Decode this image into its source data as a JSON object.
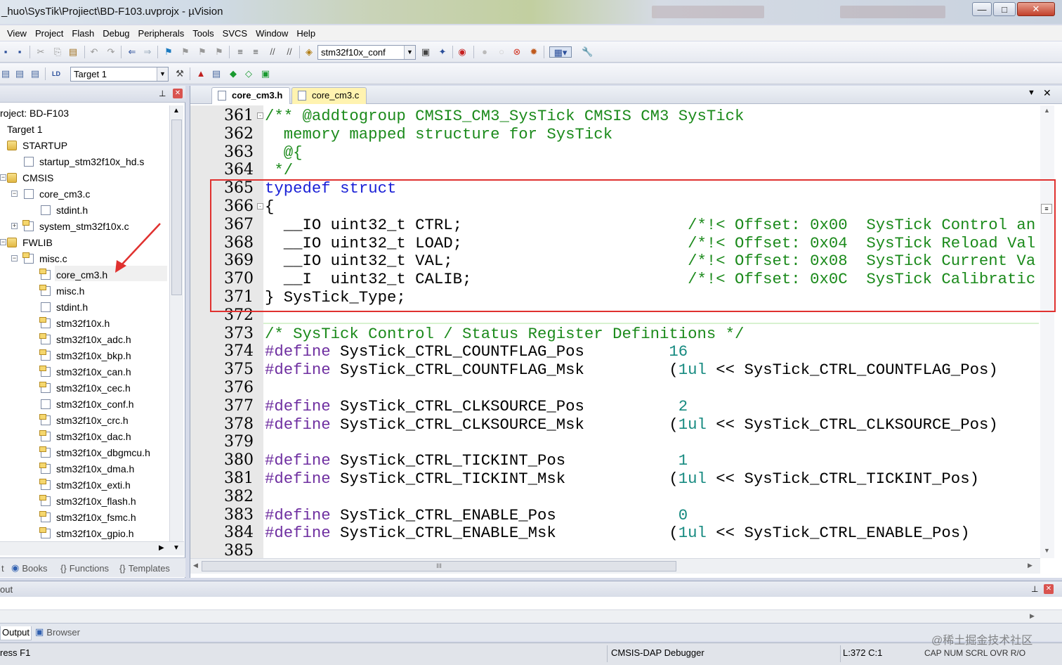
{
  "window": {
    "title": "_huo\\SysTik\\Projiect\\BD-F103.uvprojx - µVision",
    "buttons": [
      "—",
      "□",
      "✕"
    ]
  },
  "menu": [
    "View",
    "Project",
    "Flash",
    "Debug",
    "Peripherals",
    "Tools",
    "SVCS",
    "Window",
    "Help"
  ],
  "toolbar": {
    "config_combo": "stm32f10x_conf",
    "target_combo": "Target 1"
  },
  "project_panel": {
    "tree": [
      {
        "label": "roject: BD-F103",
        "level": 0,
        "icon": "none"
      },
      {
        "label": "Target 1",
        "level": 1,
        "icon": "none"
      },
      {
        "label": "STARTUP",
        "level": 2,
        "icon": "folder"
      },
      {
        "label": "startup_stm32f10x_hd.s",
        "level": 3,
        "icon": "file"
      },
      {
        "label": "CMSIS",
        "level": 2,
        "icon": "folder"
      },
      {
        "label": "core_cm3.c",
        "level": 3,
        "icon": "file"
      },
      {
        "label": "stdint.h",
        "level": 4,
        "icon": "file"
      },
      {
        "label": "system_stm32f10x.c",
        "level": 3,
        "icon": "hfile"
      },
      {
        "label": "FWLIB",
        "level": 2,
        "icon": "folder"
      },
      {
        "label": "misc.c",
        "level": 3,
        "icon": "hfile"
      },
      {
        "label": "core_cm3.h",
        "level": 4,
        "icon": "hfile"
      },
      {
        "label": "misc.h",
        "level": 4,
        "icon": "hfile"
      },
      {
        "label": "stdint.h",
        "level": 4,
        "icon": "file"
      },
      {
        "label": "stm32f10x.h",
        "level": 4,
        "icon": "hfile"
      },
      {
        "label": "stm32f10x_adc.h",
        "level": 4,
        "icon": "hfile"
      },
      {
        "label": "stm32f10x_bkp.h",
        "level": 4,
        "icon": "hfile"
      },
      {
        "label": "stm32f10x_can.h",
        "level": 4,
        "icon": "hfile"
      },
      {
        "label": "stm32f10x_cec.h",
        "level": 4,
        "icon": "hfile"
      },
      {
        "label": "stm32f10x_conf.h",
        "level": 4,
        "icon": "file"
      },
      {
        "label": "stm32f10x_crc.h",
        "level": 4,
        "icon": "hfile"
      },
      {
        "label": "stm32f10x_dac.h",
        "level": 4,
        "icon": "hfile"
      },
      {
        "label": "stm32f10x_dbgmcu.h",
        "level": 4,
        "icon": "hfile"
      },
      {
        "label": "stm32f10x_dma.h",
        "level": 4,
        "icon": "hfile"
      },
      {
        "label": "stm32f10x_exti.h",
        "level": 4,
        "icon": "hfile"
      },
      {
        "label": "stm32f10x_flash.h",
        "level": 4,
        "icon": "hfile"
      },
      {
        "label": "stm32f10x_fsmc.h",
        "level": 4,
        "icon": "hfile"
      },
      {
        "label": "stm32f10x_gpio.h",
        "level": 4,
        "icon": "hfile"
      }
    ],
    "tabs": [
      "t",
      "Books",
      "Functions",
      "Templates"
    ]
  },
  "editor": {
    "tabs": [
      "core_cm3.h",
      "core_cm3.c"
    ],
    "lines": [
      {
        "n": "361",
        "fold": "-",
        "parts": [
          [
            "cmt",
            "/** @addtogroup CMSIS_CM3_SysTick CMSIS CM3 SysTick"
          ]
        ]
      },
      {
        "n": "362",
        "parts": [
          [
            "cmt",
            "  memory mapped structure for SysTick"
          ]
        ]
      },
      {
        "n": "363",
        "parts": [
          [
            "cmt",
            "  @{"
          ]
        ]
      },
      {
        "n": "364",
        "parts": [
          [
            "cmt",
            " */"
          ]
        ]
      },
      {
        "n": "365",
        "parts": [
          [
            "kw",
            "typedef"
          ],
          [
            "",
            " "
          ],
          [
            "kw",
            "struct"
          ]
        ]
      },
      {
        "n": "366",
        "fold": "-",
        "parts": [
          [
            "",
            "{"
          ]
        ]
      },
      {
        "n": "367",
        "parts": [
          [
            "",
            "  __IO uint32_t CTRL;                        "
          ],
          [
            "cmt",
            "/*!< Offset: 0x00  SysTick Control an"
          ]
        ]
      },
      {
        "n": "368",
        "parts": [
          [
            "",
            "  __IO uint32_t LOAD;                        "
          ],
          [
            "cmt",
            "/*!< Offset: 0x04  SysTick Reload Val"
          ]
        ]
      },
      {
        "n": "369",
        "parts": [
          [
            "",
            "  __IO uint32_t VAL;                         "
          ],
          [
            "cmt",
            "/*!< Offset: 0x08  SysTick Current Va"
          ]
        ]
      },
      {
        "n": "370",
        "parts": [
          [
            "",
            "  __I  uint32_t CALIB;                       "
          ],
          [
            "cmt",
            "/*!< Offset: 0x0C  SysTick Calibratic"
          ]
        ]
      },
      {
        "n": "371",
        "parts": [
          [
            "",
            "} SysTick_Type;"
          ]
        ]
      },
      {
        "n": "372",
        "parts": [
          [
            "",
            ""
          ]
        ]
      },
      {
        "n": "373",
        "parts": [
          [
            "cmt",
            "/* SysTick Control / Status Register Definitions */"
          ]
        ]
      },
      {
        "n": "374",
        "parts": [
          [
            "pp",
            "#define"
          ],
          [
            "",
            " SysTick_CTRL_COUNTFLAG_Pos         "
          ],
          [
            "num",
            "16"
          ]
        ]
      },
      {
        "n": "375",
        "parts": [
          [
            "pp",
            "#define"
          ],
          [
            "",
            " SysTick_CTRL_COUNTFLAG_Msk         "
          ],
          [
            "",
            "("
          ],
          [
            "num",
            "1ul"
          ],
          [
            "",
            " << SysTick_CTRL_COUNTFLAG_Pos)"
          ]
        ]
      },
      {
        "n": "376",
        "parts": [
          [
            "",
            ""
          ]
        ]
      },
      {
        "n": "377",
        "parts": [
          [
            "pp",
            "#define"
          ],
          [
            "",
            " SysTick_CTRL_CLKSOURCE_Pos          "
          ],
          [
            "num",
            "2"
          ]
        ]
      },
      {
        "n": "378",
        "parts": [
          [
            "pp",
            "#define"
          ],
          [
            "",
            " SysTick_CTRL_CLKSOURCE_Msk         "
          ],
          [
            "",
            "("
          ],
          [
            "num",
            "1ul"
          ],
          [
            "",
            " << SysTick_CTRL_CLKSOURCE_Pos)"
          ]
        ]
      },
      {
        "n": "379",
        "parts": [
          [
            "",
            ""
          ]
        ]
      },
      {
        "n": "380",
        "parts": [
          [
            "pp",
            "#define"
          ],
          [
            "",
            " SysTick_CTRL_TICKINT_Pos            "
          ],
          [
            "num",
            "1"
          ]
        ]
      },
      {
        "n": "381",
        "parts": [
          [
            "pp",
            "#define"
          ],
          [
            "",
            " SysTick_CTRL_TICKINT_Msk           "
          ],
          [
            "",
            "("
          ],
          [
            "num",
            "1ul"
          ],
          [
            "",
            " << SysTick_CTRL_TICKINT_Pos)"
          ]
        ]
      },
      {
        "n": "382",
        "parts": [
          [
            "",
            ""
          ]
        ]
      },
      {
        "n": "383",
        "parts": [
          [
            "pp",
            "#define"
          ],
          [
            "",
            " SysTick_CTRL_ENABLE_Pos             "
          ],
          [
            "num",
            "0"
          ]
        ]
      },
      {
        "n": "384",
        "parts": [
          [
            "pp",
            "#define"
          ],
          [
            "",
            " SysTick_CTRL_ENABLE_Msk            "
          ],
          [
            "",
            "("
          ],
          [
            "num",
            "1ul"
          ],
          [
            "",
            " << SysTick_CTRL_ENABLE_Pos)"
          ]
        ]
      },
      {
        "n": "385",
        "parts": [
          [
            "",
            ""
          ]
        ]
      }
    ]
  },
  "output": {
    "title": "out",
    "tabs": [
      "Output",
      "Browser"
    ]
  },
  "status": {
    "left": "ress F1",
    "debugger": "CMSIS-DAP Debugger",
    "position": "L:372 C:1",
    "flags": "CAP  NUM  SCRL  OVR  R/O",
    "watermark": "@稀土掘金技术社区"
  },
  "colors": {
    "highlight_box": "#e0312f",
    "keyword": "#1a20d6",
    "comment": "#1b8a1b",
    "preprocessor": "#6e2ea0",
    "number": "#168a80"
  }
}
